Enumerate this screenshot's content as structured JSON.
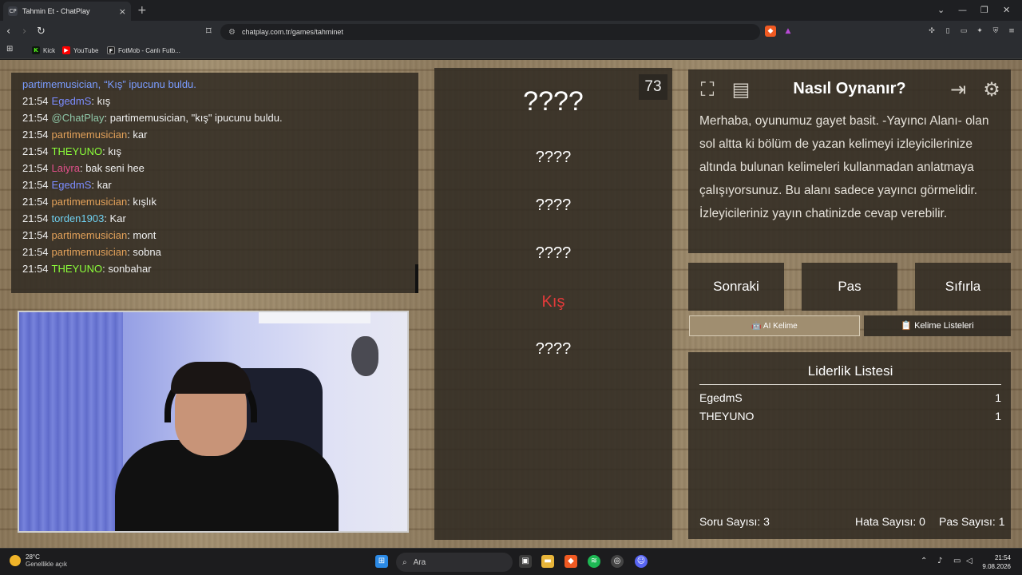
{
  "browser": {
    "tab_title": "Tahmin Et - ChatPlay",
    "tab_favicon": "CP",
    "url": "chatplay.com.tr/games/tahminet",
    "bookmarks": [
      {
        "label": "Kick",
        "icon": "K",
        "color": "#53fc18"
      },
      {
        "label": "YouTube",
        "icon": "▶",
        "color": "#ff0000"
      },
      {
        "label": "FotMob - Canlı Futb...",
        "icon": "F",
        "color": "#1a1a1a"
      }
    ]
  },
  "chat": {
    "messages": [
      {
        "time": "",
        "user": "partimemusician,",
        "user_color": "#7a9cff",
        "text": "“Kış” ipucunu buldu.",
        "special": true
      },
      {
        "time": "21:54",
        "user": "EgedmS",
        "user_color": "#7b8cff",
        "text": ": kış"
      },
      {
        "time": "21:54",
        "user": "@ChatPlay",
        "user_color": "#8fc7a8",
        "text": ": partimemusician, \"kış\" ipucunu buldu."
      },
      {
        "time": "21:54",
        "user": "partimemusician",
        "user_color": "#e4a25a",
        "text": ": kar"
      },
      {
        "time": "21:54",
        "user": "THEYUNO",
        "user_color": "#8cff3a",
        "text": ": kış"
      },
      {
        "time": "21:54",
        "user": "Laiyra",
        "user_color": "#e0508a",
        "text": ": bak seni hee"
      },
      {
        "time": "21:54",
        "user": "EgedmS",
        "user_color": "#7b8cff",
        "text": ": kar"
      },
      {
        "time": "21:54",
        "user": "partimemusician",
        "user_color": "#e4a25a",
        "text": ": kışlık"
      },
      {
        "time": "21:54",
        "user": "torden1903",
        "user_color": "#6fd0f0",
        "text": ": Kar"
      },
      {
        "time": "21:54",
        "user": "partimemusician",
        "user_color": "#e4a25a",
        "text": ": mont"
      },
      {
        "time": "21:54",
        "user": "partimemusician",
        "user_color": "#e4a25a",
        "text": ": sobna"
      },
      {
        "time": "21:54",
        "user": "THEYUNO",
        "user_color": "#8cff3a",
        "text": ": sonbahar"
      }
    ]
  },
  "game": {
    "counter": "73",
    "main_word": "????",
    "hints": [
      "????",
      "????",
      "????",
      "Kış",
      "????"
    ]
  },
  "howto": {
    "title": "Nasıl Oynanır?",
    "text": "Merhaba, oyunumuz gayet basit. -Yayıncı Alanı- olan sol altta ki bölüm de yazan kelimeyi izleyicilerinize altında bulunan kelimeleri kullanmadan anlatmaya çalışıyorsunuz. Bu alanı sadece yayıncı görmelidir. İzleyicileriniz yayın chatinizde cevap verebilir."
  },
  "controls": {
    "next": "Sonraki",
    "pass": "Pas",
    "reset": "Sıfırla",
    "ai_word": "🤖 AI Kelime",
    "word_lists": "📋 Kelime Listeleri"
  },
  "leaderboard": {
    "title": "Liderlik Listesi",
    "rows": [
      {
        "name": "EgedmS",
        "score": "1"
      },
      {
        "name": "THEYUNO",
        "score": "1"
      }
    ]
  },
  "stats": {
    "questions": "Soru Sayısı: 3",
    "errors": "Hata Sayısı: 0",
    "passes": "Pas Sayısı: 1"
  },
  "taskbar": {
    "temp": "28°C",
    "weather": "Genellikle açık",
    "search_placeholder": "Ara",
    "time": "21:54",
    "date": "9.08.2026"
  },
  "colors": {
    "accent_red": "#e23a3a",
    "panel": "#302a22"
  }
}
